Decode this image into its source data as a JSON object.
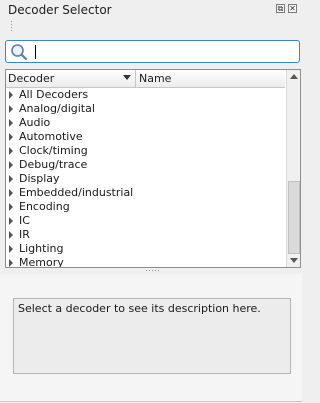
{
  "window": {
    "title": "Decoder Selector",
    "float_glyph": "⧉",
    "close_glyph": "✕"
  },
  "search": {
    "value": "",
    "icon": "magnifier-icon"
  },
  "tree": {
    "columns": [
      "Decoder",
      "Name"
    ],
    "sort": "descending",
    "categories": [
      "All Decoders",
      "Analog/digital",
      "Audio",
      "Automotive",
      "Clock/timing",
      "Debug/trace",
      "Display",
      "Embedded/industrial",
      "Encoding",
      "IC",
      "IR",
      "Lighting",
      "Memory"
    ]
  },
  "description": {
    "text": "Select a decoder to see its description here."
  },
  "colors": {
    "accent": "#3d86c6",
    "panel": "#efefef"
  }
}
